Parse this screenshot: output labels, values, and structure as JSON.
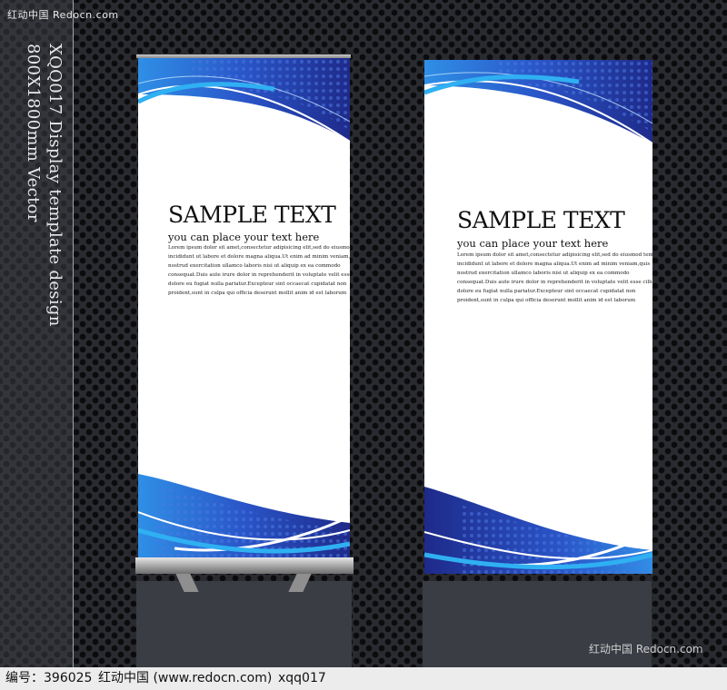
{
  "watermark_top": "红动中国 Redocn.com",
  "side_title": "XQQ017 Display template design\n800X1800mm Vector",
  "banners": [
    {
      "title": "SAMPLE TEXT",
      "subtitle": "you can place your text here",
      "body": [
        "Lorem ipsum dolor sit amet,consectetur adipisicing elit,sed do eiusmod tempor",
        "incididunt ut labore et dolore magna aliqua.Ut enim ad minim veniam,quis",
        "nostrud exercitation ullamco laboris nisi ut aliquip ex ea commodo",
        "consequat.Duis aute irure dolor in reprehenderit in voluptate velit esse cillum",
        "dolore eu fugiat nulla pariatur.Excepteur sint occaecat cupidatat non",
        "proident,sunt in culpa qui officia deserunt mollit anim id est laborum"
      ]
    },
    {
      "title": "SAMPLE TEXT",
      "subtitle": "you can place your text here",
      "body": [
        "Lorem ipsum dolor sit amet,consectetur adipisicing elit,sed do eiusmod tempor",
        "incididunt ut labore et dolore magna aliqua.Ut enim ad minim veniam,quis",
        "nostrud exercitation ullamco laboris nisi ut aliquip ex ea commodo",
        "consequat.Duis aute irure dolor in reprehenderit in voluptate velit esse cillum",
        "dolore eu fugiat nulla pariatur.Excepteur sint occaecat cupidatat non",
        "proident,sunt in culpa qui officia deserunt mollit anim id est laborum"
      ]
    }
  ],
  "watermark_bottom_right": "红动中国 Redocn.com",
  "footer": {
    "id_text": "编号：396025",
    "site_text": "红动中国 (www.redocn.com)",
    "code_text": "xqq017"
  },
  "colors": {
    "dark_blue": "#1f2a8c",
    "mid_blue": "#2f5fd0",
    "light_blue": "#2fa8ee",
    "background": "#2a2b30"
  }
}
